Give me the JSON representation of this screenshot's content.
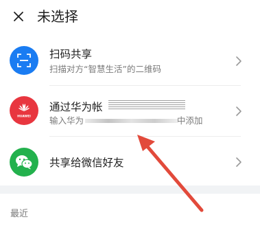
{
  "header": {
    "title": "未选择"
  },
  "options": [
    {
      "title": "扫码共享",
      "subtitle": "扫描对方“智慧生活”的二维码",
      "icon": "scan-icon",
      "icon_bg": "#1a7cf2"
    },
    {
      "title": "通过华为帐",
      "subtitle_prefix": "输入华为",
      "subtitle_suffix": "中添加",
      "icon": "huawei-logo-icon",
      "icon_bg": "#e8363f",
      "logo_text": "HUAWEI"
    },
    {
      "title": "共享给微信好友",
      "icon": "wechat-icon",
      "icon_bg": "#23b14d"
    }
  ],
  "section": {
    "recent_label": "最近"
  },
  "annotation": {
    "arrow_color": "#e24a3b"
  }
}
